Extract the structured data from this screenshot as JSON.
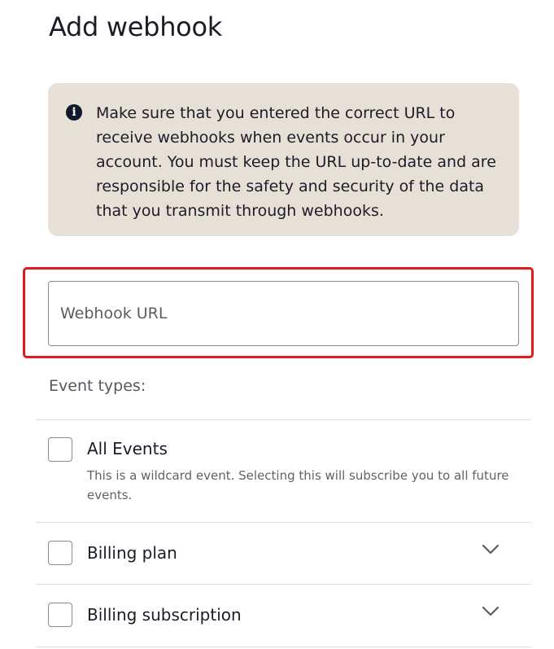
{
  "page": {
    "title": "Add webhook"
  },
  "notice": {
    "icon": "info-icon",
    "icon_glyph": "i",
    "text": "Make sure that you entered the correct URL to receive webhooks when events occur in your account. You must keep the URL up-to-date and are responsible for the safety and security of the data that you transmit through webhooks."
  },
  "webhook_url": {
    "placeholder": "Webhook URL",
    "value": ""
  },
  "event_types": {
    "label": "Event types:",
    "items": [
      {
        "label": "All Events",
        "description": "This is a wildcard event. Selecting this will subscribe you to all future events.",
        "checked": false
      },
      {
        "label": "Billing plan",
        "checked": false,
        "expandable": true
      },
      {
        "label": "Billing subscription",
        "checked": false,
        "expandable": true
      }
    ]
  },
  "colors": {
    "notice_bg": "#e7e0d7",
    "highlight": "#e8171d",
    "text": "#1c1c28"
  }
}
